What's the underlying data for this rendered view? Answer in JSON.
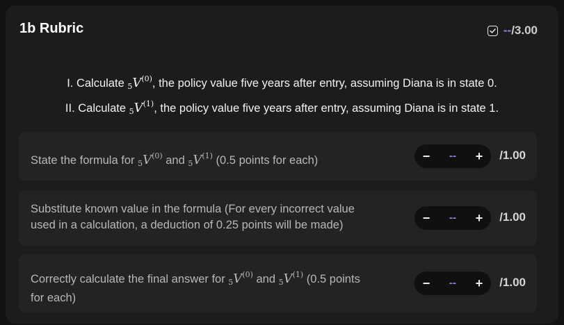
{
  "header": {
    "title": "1b Rubric",
    "score_value": "--",
    "score_total": "/3.00",
    "check_icon": "checkbox-checked-icon"
  },
  "questions": [
    {
      "prefix": "I. Calculate ",
      "math_sub": "5",
      "math_var": "V",
      "math_sup": "(0)",
      "suffix": ", the policy value five years after entry, assuming Diana is in state 0."
    },
    {
      "prefix": "II. Calculate ",
      "math_sub": "5",
      "math_var": "V",
      "math_sup": "(1)",
      "suffix": ", the policy value five years after entry, assuming Diana is in state 1."
    }
  ],
  "criteria": [
    {
      "text_a": "State the formula for ",
      "m1_sub": "5",
      "m1_var": "V",
      "m1_sup": "(0)",
      "text_b": " and ",
      "m2_sub": "5",
      "m2_var": "V",
      "m2_sup": "(1)",
      "text_c": " (0.5 points for each)",
      "minus": "−",
      "value": "--",
      "plus": "+",
      "max": "/1.00"
    },
    {
      "line1": "Substitute known value in the formula (For every incorrect value",
      "line2": "used in a calculation, a deduction of 0.25 points will be made)",
      "minus": "−",
      "value": "--",
      "plus": "+",
      "max": "/1.00"
    },
    {
      "text_a": "Correctly calculate the final answer for ",
      "m1_sub": "5",
      "m1_var": "V",
      "m1_sup": "(0)",
      "text_b": " and ",
      "m2_sub": "5",
      "m2_var": "V",
      "m2_sup": "(1)",
      "text_c": " (0.5 points",
      "line2": "for each)",
      "minus": "−",
      "value": "--",
      "plus": "+",
      "max": "/1.00"
    }
  ],
  "colors": {
    "background": "#121212",
    "panel": "#1c1c1c",
    "card": "#232323",
    "accent": "#8f8ae0"
  }
}
